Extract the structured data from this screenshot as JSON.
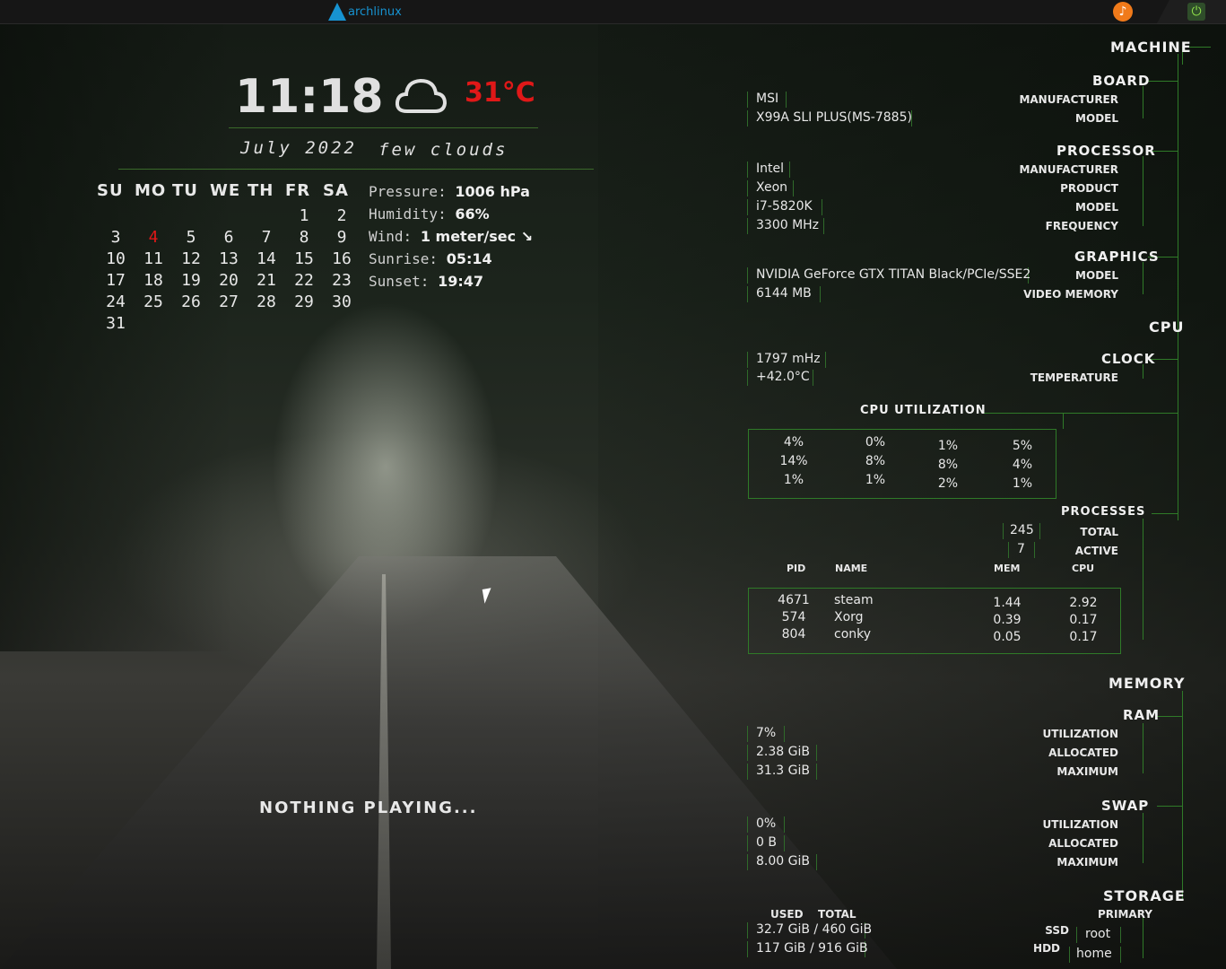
{
  "topbar": {
    "arch_text": "archlinux"
  },
  "clock": {
    "time": "11:18",
    "temperature": "31°C",
    "date": "July 2022",
    "weather": "few clouds"
  },
  "calendar": {
    "headers": [
      "SU",
      "MO",
      "TU",
      "WE",
      "TH",
      "FR",
      "SA"
    ],
    "rows": [
      [
        "",
        "",
        "",
        "",
        "",
        "1",
        "2"
      ],
      [
        "3",
        "4",
        "5",
        "6",
        "7",
        "8",
        "9"
      ],
      [
        "10",
        "11",
        "12",
        "13",
        "14",
        "15",
        "16"
      ],
      [
        "17",
        "18",
        "19",
        "20",
        "21",
        "22",
        "23"
      ],
      [
        "24",
        "25",
        "26",
        "27",
        "28",
        "29",
        "30"
      ],
      [
        "31",
        "",
        "",
        "",
        "",
        "",
        ""
      ]
    ],
    "today": "4"
  },
  "weather": {
    "pressure_label": "Pressure:",
    "pressure": "1006 hPa",
    "humidity_label": "Humidity:",
    "humidity": "66%",
    "wind_label": "Wind:",
    "wind": "1 meter/sec ↘",
    "sunrise_label": "Sunrise:",
    "sunrise": "05:14",
    "sunset_label": "Sunset:",
    "sunset": "19:47"
  },
  "player": {
    "status": "NOTHING PLAYING..."
  },
  "machine": {
    "title": "MACHINE",
    "board": {
      "title": "BOARD",
      "manufacturer_label": "MANUFACTURER",
      "model_label": "MODEL",
      "manufacturer": "MSI",
      "model": "X99A SLI PLUS(MS-7885)"
    },
    "processor": {
      "title": "PROCESSOR",
      "manufacturer_label": "MANUFACTURER",
      "product_label": "PRODUCT",
      "model_label": "MODEL",
      "frequency_label": "FREQUENCY",
      "manufacturer": "Intel",
      "product": "Xeon",
      "model": "i7-5820K",
      "frequency": "3300 MHz"
    },
    "graphics": {
      "title": "GRAPHICS",
      "model_label": "MODEL",
      "memory_label": "VIDEO MEMORY",
      "model": "NVIDIA GeForce GTX TITAN Black/PCIe/SSE2",
      "memory": "6144 MB"
    }
  },
  "cpu": {
    "title": "CPU",
    "clock_label": "CLOCK",
    "temperature_label": "TEMPERATURE",
    "clock": "1797 mHz",
    "temperature": "+42.0°C",
    "utilization_title": "CPU UTILIZATION",
    "cores": [
      [
        "4%",
        "0%",
        "1%",
        "5%"
      ],
      [
        "14%",
        "8%",
        "8%",
        "4%"
      ],
      [
        "1%",
        "1%",
        "2%",
        "1%"
      ]
    ]
  },
  "processes": {
    "title": "PROCESSES",
    "total_label": "TOTAL",
    "active_label": "ACTIVE",
    "total": "245",
    "active": "7",
    "headers": {
      "pid": "PID",
      "name": "NAME",
      "mem": "MEM",
      "cpu": "CPU"
    },
    "rows": [
      {
        "pid": "4671",
        "name": "steam",
        "mem": "1.44",
        "cpu": "2.92"
      },
      {
        "pid": "574",
        "name": "Xorg",
        "mem": "0.39",
        "cpu": "0.17"
      },
      {
        "pid": "804",
        "name": "conky",
        "mem": "0.05",
        "cpu": "0.17"
      }
    ]
  },
  "memory": {
    "title": "MEMORY",
    "ram": {
      "title": "RAM",
      "utilization_label": "UTILIZATION",
      "allocated_label": "ALLOCATED",
      "maximum_label": "MAXIMUM",
      "utilization": "7%",
      "allocated": "2.38 GiB",
      "maximum": "31.3 GiB"
    },
    "swap": {
      "title": "SWAP",
      "utilization_label": "UTILIZATION",
      "allocated_label": "ALLOCATED",
      "maximum_label": "MAXIMUM",
      "utilization": "0%",
      "allocated": "0 B",
      "maximum": "8.00 GiB"
    }
  },
  "storage": {
    "title": "STORAGE",
    "primary_label": "PRIMARY",
    "used_label": "USED",
    "total_label": "TOTAL",
    "ssd_label": "SSD",
    "hdd_label": "HDD",
    "root_label": "root",
    "home_label": "home",
    "root": "32.7 GiB / 460 GiB",
    "home": "117 GiB / 916 GiB"
  }
}
